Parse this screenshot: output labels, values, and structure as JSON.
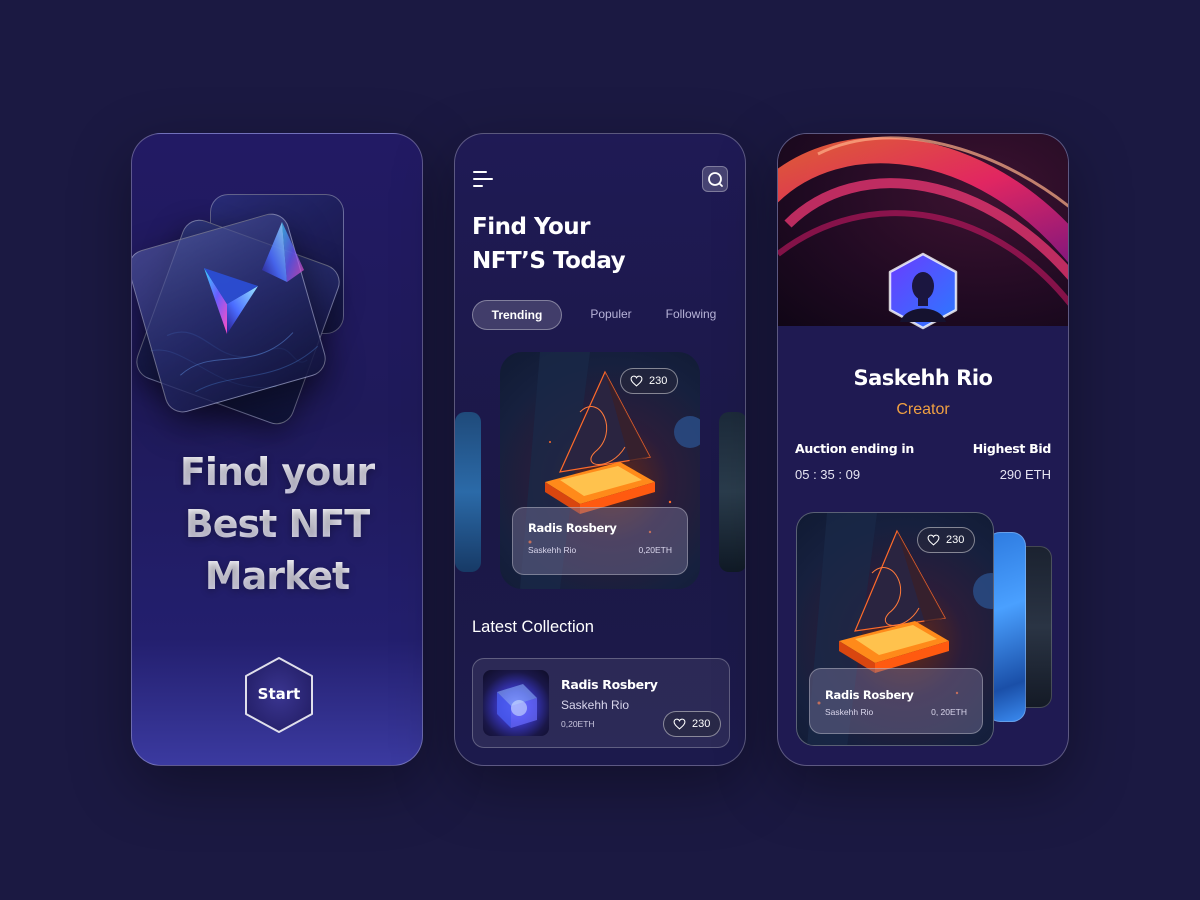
{
  "screen_onboarding": {
    "headline": [
      "Find your",
      "Best NFT",
      "Market"
    ],
    "start_label": "Start"
  },
  "screen_home": {
    "title_lines": [
      "Find Your",
      "NFT’S Today"
    ],
    "tabs": [
      {
        "label": "Trending",
        "active": true
      },
      {
        "label": "Populer",
        "active": false
      },
      {
        "label": "Following",
        "active": false
      }
    ],
    "featured": {
      "likes": "230",
      "name": "Radis Rosbery",
      "creator": "Saskehh Rio",
      "price": "0,20ETH"
    },
    "latest_title": "Latest Collection",
    "latest_item": {
      "name": "Radis Rosbery",
      "creator": "Saskehh Rio",
      "price": "0,20ETH",
      "likes": "230"
    }
  },
  "screen_profile": {
    "name": "Saskehh Rio",
    "role": "Creator",
    "auction_label": "Auction ending in",
    "auction_value": "05 : 35 : 09",
    "bid_label": "Highest Bid",
    "bid_value": "290 ETH",
    "card": {
      "likes": "230",
      "name": "Radis Rosbery",
      "creator": "Saskehh Rio",
      "price": "0, 20ETH"
    }
  },
  "colors": {
    "background": "#1b1942",
    "accent_orange": "#f0a042",
    "panel": "#1f1a55"
  },
  "icons": [
    "ethereum-icon",
    "menu-icon",
    "search-icon",
    "heart-icon"
  ]
}
